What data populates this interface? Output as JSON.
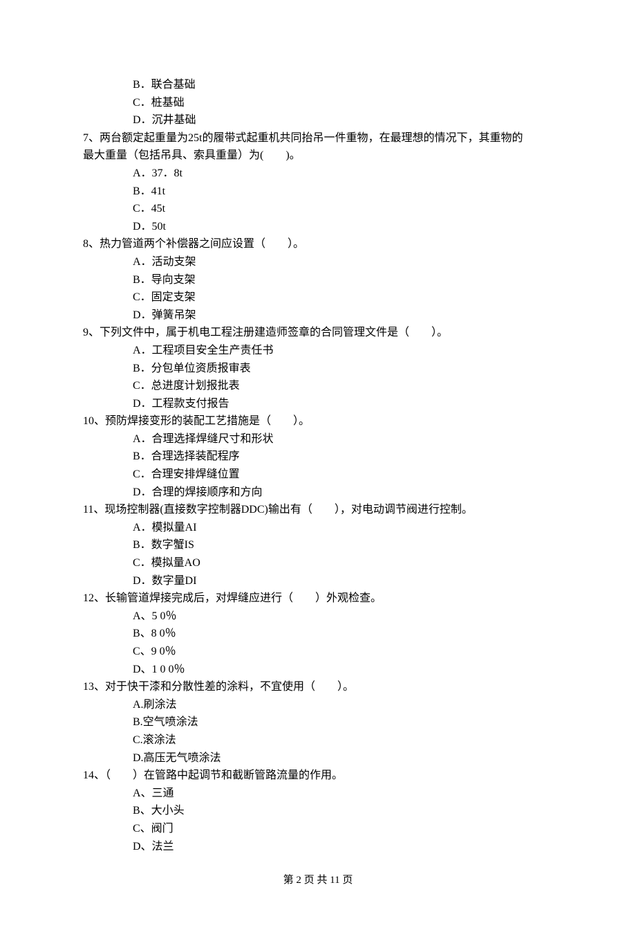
{
  "prev_opts": {
    "B": "B．联合基础",
    "C": "C．桩基础",
    "D": "D．沉井基础"
  },
  "q7": {
    "line1": "7、两台额定起重量为25t的履带式起重机共同抬吊一件重物，在最理想的情况下，其重物的",
    "line2": "最大重量（包括吊具、索具重量）为(　　)。",
    "opts": {
      "A": "A．37．8t",
      "B": "B．41t",
      "C": "C．45t",
      "D": "D．50t"
    }
  },
  "q8": {
    "stem": "8、热力管道两个补偿器之间应设置（　　）。",
    "opts": {
      "A": "A．活动支架",
      "B": "B．导向支架",
      "C": "C．固定支架",
      "D": "D．弹簧吊架"
    }
  },
  "q9": {
    "stem": "9、下列文件中，属于机电工程注册建造师签章的合同管理文件是（　　）。",
    "opts": {
      "A": "A．工程项目安全生产责任书",
      "B": "B．分包单位资质报审表",
      "C": "C．总进度计划报批表",
      "D": "D．工程款支付报告"
    }
  },
  "q10": {
    "stem": "10、预防焊接变形的装配工艺措施是（　　）。",
    "opts": {
      "A": "A．合理选择焊缝尺寸和形状",
      "B": "B．合理选择装配程序",
      "C": "C．合理安排焊缝位置",
      "D": "D．合理的焊接顺序和方向"
    }
  },
  "q11": {
    "stem": "11、现场控制器(直接数字控制器DDC)输出有（　　），对电动调节阀进行控制。",
    "opts": {
      "A": "A．模拟量AI",
      "B": "B．数字蟹IS",
      "C": "C．模拟量AO",
      "D": "D．数字量DI"
    }
  },
  "q12": {
    "stem": "12、长输管道焊接完成后，对焊缝应进行（　　）外观检查。",
    "opts": {
      "A": "A、5 0％",
      "B": "B、8 0％",
      "C": "C、9 0％",
      "D": "D、1 0 0％"
    }
  },
  "q13": {
    "stem": "13、对于快干漆和分散性差的涂料，不宜使用（　　）。",
    "opts": {
      "A": "A.刷涂法",
      "B": "B.空气喷涂法",
      "C": "C.滚涂法",
      "D": "D.高压无气喷涂法"
    }
  },
  "q14": {
    "stem": "14、（　　）在管路中起调节和截断管路流量的作用。",
    "opts": {
      "A": "A、三通",
      "B": "B、大小头",
      "C": "C、阀门",
      "D": "D、法兰"
    }
  },
  "footer": "第 2 页 共 11 页"
}
